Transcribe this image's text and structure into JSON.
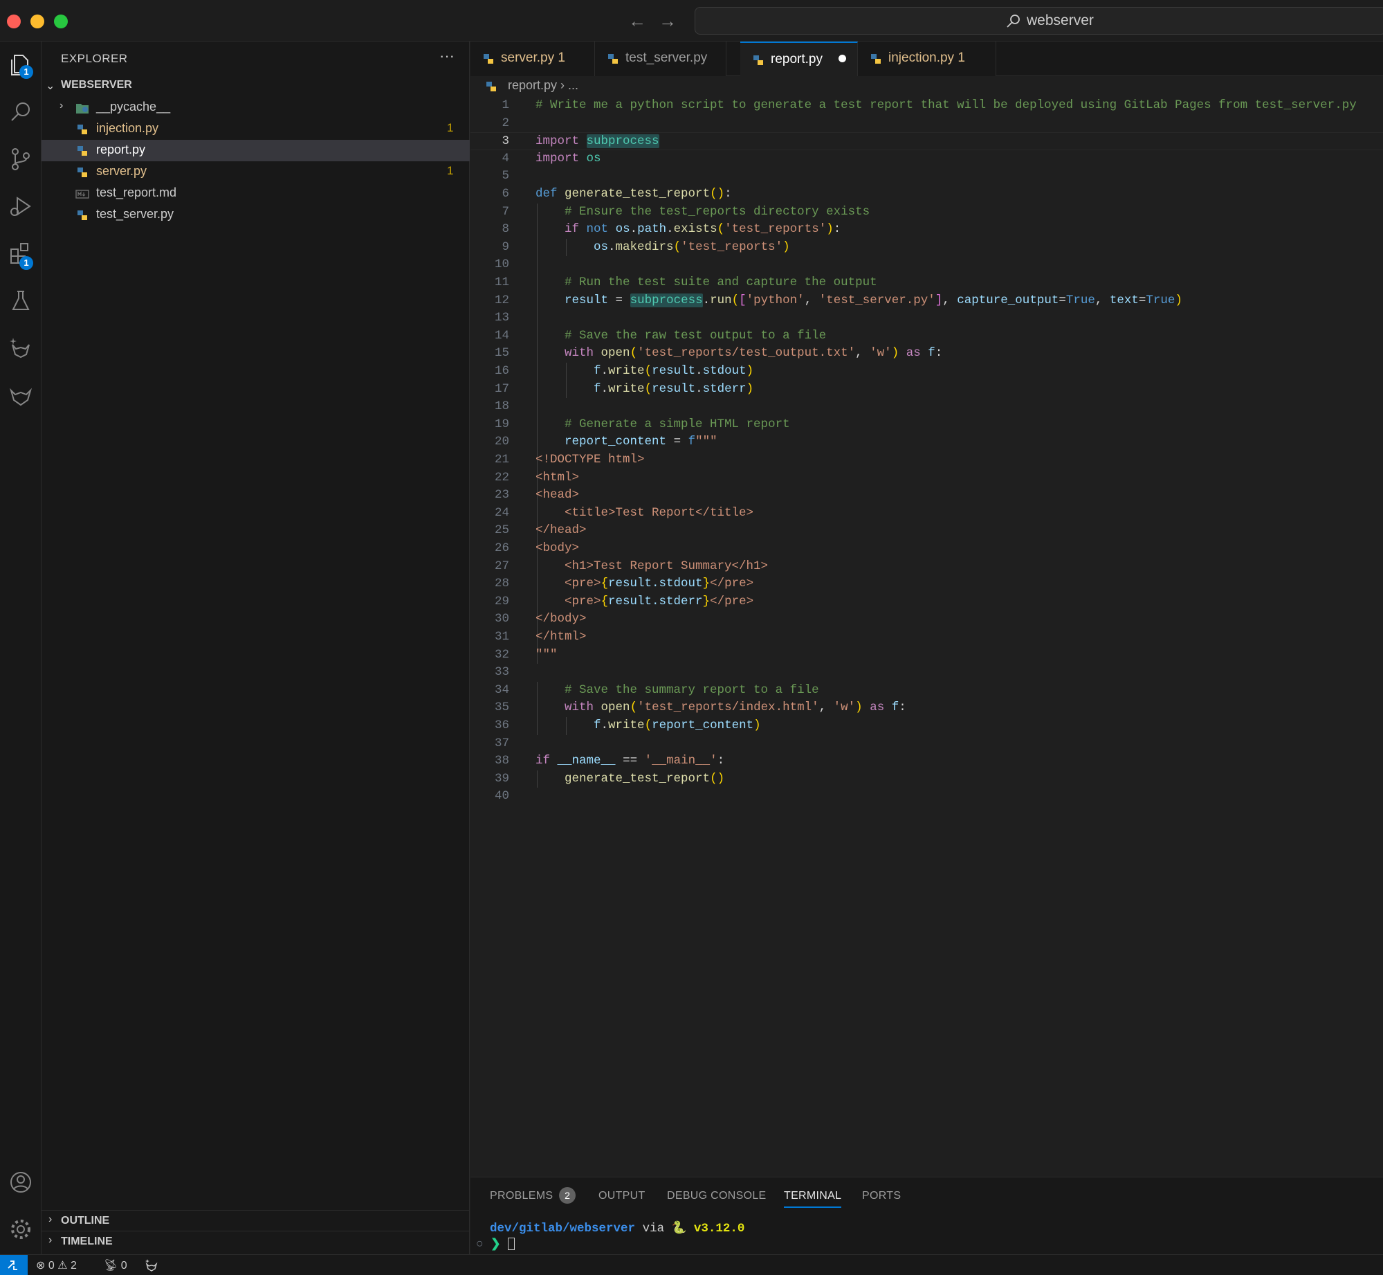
{
  "window": {
    "search_text": "webserver"
  },
  "activity_bar": {
    "explorer_badge": "1",
    "extensions_badge": "1"
  },
  "sidebar": {
    "title": "EXPLORER",
    "more": "···",
    "workspace": "WEBSERVER",
    "items": [
      {
        "name": "__pycache__",
        "type": "folder",
        "count": ""
      },
      {
        "name": "injection.py",
        "type": "python",
        "count": "1"
      },
      {
        "name": "report.py",
        "type": "python",
        "count": ""
      },
      {
        "name": "server.py",
        "type": "python",
        "count": "1"
      },
      {
        "name": "test_report.md",
        "type": "markdown",
        "count": ""
      },
      {
        "name": "test_server.py",
        "type": "python",
        "count": ""
      }
    ],
    "outline_label": "OUTLINE",
    "timeline_label": "TIMELINE"
  },
  "tabs": [
    {
      "label": "server.py",
      "suffix": "1"
    },
    {
      "label": "test_server.py",
      "suffix": ""
    },
    {
      "label": "report.py",
      "suffix": ""
    },
    {
      "label": "injection.py",
      "suffix": "1"
    }
  ],
  "breadcrumb": {
    "file": "report.py",
    "rest": "..."
  },
  "editor": {
    "current_line": 3,
    "lines": [
      "# Write me a python script to generate a test report that will be deployed using GitLab Pages from test_server.py",
      "",
      "import subprocess",
      "import os",
      "",
      "def generate_test_report():",
      "    # Ensure the test_reports directory exists",
      "    if not os.path.exists('test_reports'):",
      "        os.makedirs('test_reports')",
      "",
      "    # Run the test suite and capture the output",
      "    result = subprocess.run(['python', 'test_server.py'], capture_output=True, text=True)",
      "",
      "    # Save the raw test output to a file",
      "    with open('test_reports/test_output.txt', 'w') as f:",
      "        f.write(result.stdout)",
      "        f.write(result.stderr)",
      "",
      "    # Generate a simple HTML report",
      "    report_content = f\"\"\"",
      "<!DOCTYPE html>",
      "<html>",
      "<head>",
      "    <title>Test Report</title>",
      "</head>",
      "<body>",
      "    <h1>Test Report Summary</h1>",
      "    <pre>{result.stdout}</pre>",
      "    <pre>{result.stderr}</pre>",
      "</body>",
      "</html>",
      "\"\"\"",
      "",
      "    # Save the summary report to a file",
      "    with open('test_reports/index.html', 'w') as f:",
      "        f.write(report_content)",
      "",
      "if __name__ == '__main__':",
      "    generate_test_report()",
      ""
    ]
  },
  "panel": {
    "tabs": [
      "PROBLEMS",
      "OUTPUT",
      "DEBUG CONSOLE",
      "TERMINAL",
      "PORTS"
    ],
    "problems_count": "2",
    "terminal": {
      "path": "dev/gitlab/webserver",
      "via": "via",
      "snake": "🐍",
      "version": "v3.12.0",
      "prompt": "❯"
    }
  },
  "status": {
    "errors": "0",
    "warnings": "2",
    "ports": "0"
  },
  "colors": {
    "accent": "#0078d4",
    "modified": "#e2c08d",
    "comment": "#6a9955",
    "keyword": "#c586c0",
    "string": "#ce9178"
  }
}
